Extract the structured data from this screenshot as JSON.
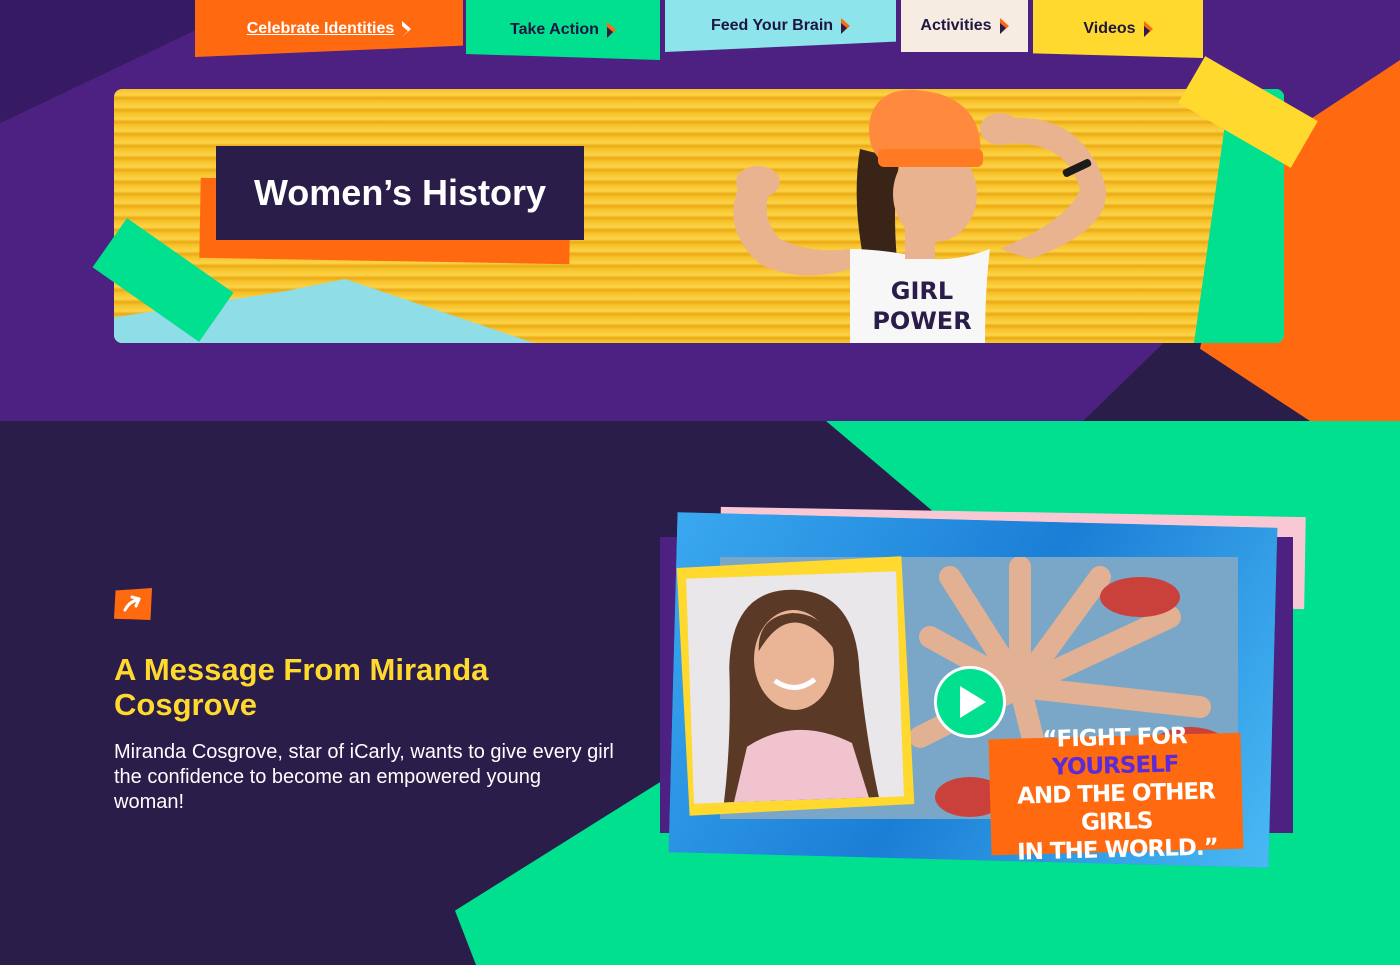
{
  "nav": {
    "tabs": [
      {
        "label": "Celebrate Identities"
      },
      {
        "label": "Take Action"
      },
      {
        "label": "Feed Your Brain"
      },
      {
        "label": "Activities"
      },
      {
        "label": "Videos"
      }
    ]
  },
  "hero": {
    "title": "Women’s History",
    "shirt_text_line1": "GIRL",
    "shirt_text_line2": "POWER"
  },
  "feature": {
    "title": "A Message From Miranda Cosgrove",
    "description": "Miranda Cosgrove, star of iCarly, wants to give every girl the confidence to become an empowered young woman!",
    "quote": {
      "part1": "“FIGHT FOR ",
      "highlight": "YOURSELF",
      "line2": "AND THE OTHER GIRLS",
      "line3": "IN THE WORLD.”"
    }
  },
  "colors": {
    "purple": "#4d2181",
    "dark_purple": "#2a1d4a",
    "orange": "#ff6a10",
    "green": "#00e08f",
    "yellow": "#ffd92e",
    "light_blue": "#8de4ea"
  },
  "icons": {
    "nav_arrow": "bolt-arrow-icon",
    "link": "arrow-up-right-icon",
    "play": "play-icon"
  }
}
